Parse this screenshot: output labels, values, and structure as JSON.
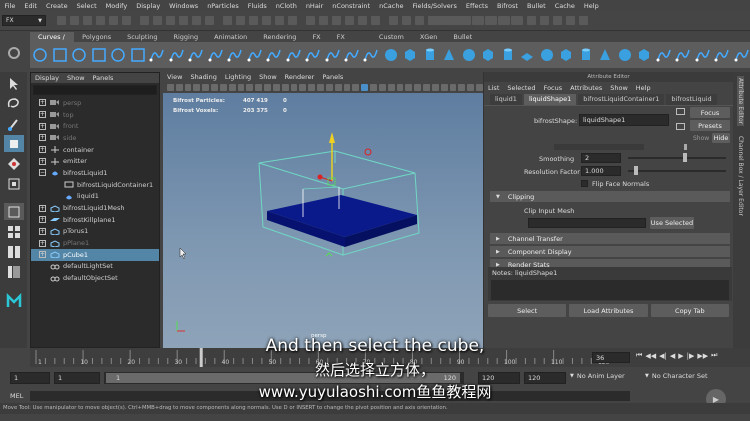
{
  "menubar": [
    "File",
    "Edit",
    "Create",
    "Select",
    "Modify",
    "Display",
    "Windows",
    "nParticles",
    "Fluids",
    "nCloth",
    "nHair",
    "nConstraint",
    "nCache",
    "Fields/Solvers",
    "Effects",
    "Bifrost",
    "Bullet",
    "Cache",
    "Help"
  ],
  "menuset": "FX",
  "shelf_tabs": [
    "Curves / Surfaces",
    "Polygons",
    "Sculpting",
    "Rigging",
    "Animation",
    "Rendering",
    "FX",
    "FX Caching",
    "Custom",
    "XGen",
    "Bullet"
  ],
  "shelf_active": "Curves / Surfaces",
  "outliner": {
    "menu": [
      "Display",
      "Show",
      "Panels"
    ],
    "items": [
      {
        "label": "persp",
        "expand": true,
        "icon": "camera-icon",
        "dim": true
      },
      {
        "label": "top",
        "expand": true,
        "icon": "camera-icon",
        "dim": true
      },
      {
        "label": "front",
        "expand": true,
        "icon": "camera-icon",
        "dim": true
      },
      {
        "label": "side",
        "expand": true,
        "icon": "camera-icon",
        "dim": true
      },
      {
        "label": "container",
        "expand": true,
        "icon": "transform-icon",
        "dim": false
      },
      {
        "label": "emitter",
        "expand": true,
        "icon": "transform-icon",
        "dim": false
      },
      {
        "label": "bifrostLiquid1",
        "expand": "minus",
        "icon": "liquid-icon",
        "dim": false
      },
      {
        "label": "bifrostLiquidContainer1",
        "expand": false,
        "icon": "container-icon",
        "dim": false,
        "indent": 1
      },
      {
        "label": "liquid1",
        "expand": false,
        "icon": "liquid-icon",
        "dim": false,
        "indent": 1
      },
      {
        "label": "bifrostLiquid1Mesh",
        "expand": true,
        "icon": "mesh-icon",
        "dim": false
      },
      {
        "label": "bifrostKillplane1",
        "expand": true,
        "icon": "plane-icon",
        "dim": false
      },
      {
        "label": "pTorus1",
        "expand": true,
        "icon": "mesh-icon",
        "dim": false
      },
      {
        "label": "pPlane1",
        "expand": true,
        "icon": "mesh-icon",
        "dim": true
      },
      {
        "label": "pCube1",
        "expand": true,
        "icon": "mesh-icon",
        "dim": false,
        "selected": true
      },
      {
        "label": "defaultLightSet",
        "expand": false,
        "icon": "set-icon",
        "dim": false
      },
      {
        "label": "defaultObjectSet",
        "expand": false,
        "icon": "set-icon",
        "dim": false
      }
    ]
  },
  "viewport": {
    "menu": [
      "View",
      "Shading",
      "Lighting",
      "Show",
      "Renderer",
      "Panels"
    ],
    "hud": [
      {
        "label": "Bifrost Particles:",
        "v1": "407 419",
        "v2": "0"
      },
      {
        "label": "Bifrost Voxels:",
        "v1": "203 375",
        "v2": "0"
      }
    ],
    "camera_label": "persp"
  },
  "attribute_editor": {
    "title": "Attribute Editor",
    "menu": [
      "List",
      "Selected",
      "Focus",
      "Attributes",
      "Show",
      "Help"
    ],
    "tabs": [
      "liquid1",
      "liquidShape1",
      "bifrostLiquidContainer1",
      "bifrostLiquid"
    ],
    "active_tab": "liquidShape1",
    "shape_label": "bifrostShape:",
    "shape_value": "liquidShape1",
    "focus_btn": "Focus",
    "presets_btn": "Presets",
    "show_label": "Show",
    "hide_btn": "Hide",
    "smoothing_label": "Smoothing",
    "smoothing_value": "2",
    "resolution_label": "Resolution Factor",
    "resolution_value": "1.000",
    "flip_label": "Flip Face Normals",
    "clipping_label": "Clipping",
    "clip_input_label": "Clip Input Mesh",
    "use_selected_btn": "Use Selected",
    "channel_transfer": "Channel Transfer",
    "component_display": "Component Display",
    "render_stats": "Render Stats",
    "notes": "Notes:  liquidShape1",
    "bottom_buttons": [
      "Select",
      "Load Attributes",
      "Copy Tab"
    ]
  },
  "right_strip": [
    "Attribute Editor",
    "Channel Box / Layer Editor"
  ],
  "timeline": {
    "current": "36",
    "ticks": [
      "1",
      "10",
      "20",
      "30",
      "40",
      "50",
      "60",
      "70",
      "80",
      "90",
      "100",
      "110",
      "120"
    ],
    "playhead_frame": 36,
    "range_max": 120
  },
  "range": {
    "start": "1",
    "start2": "1",
    "slider_left": "1",
    "slider_right": "120",
    "end": "120",
    "end2": "120",
    "anim_layer": "No Anim Layer",
    "char_set": "No Character Set"
  },
  "mel_label": "MEL",
  "help_line": "Move Tool: Use manipulator to move object(s). Ctrl+MMB+drag to move components along normals. Use D or INSERT to change the pivot position and axis orientation.",
  "subtitles": {
    "en": "And then select the cube,",
    "zh": "然后选择立方体，",
    "watermark": "www.yuyulaoshi.com鱼鱼教程网"
  },
  "colors": {
    "selection": "#5285a6",
    "viewport_top": "#5e7da0",
    "cube": "#0a1a8a",
    "container_box": "#6fd8c4"
  }
}
